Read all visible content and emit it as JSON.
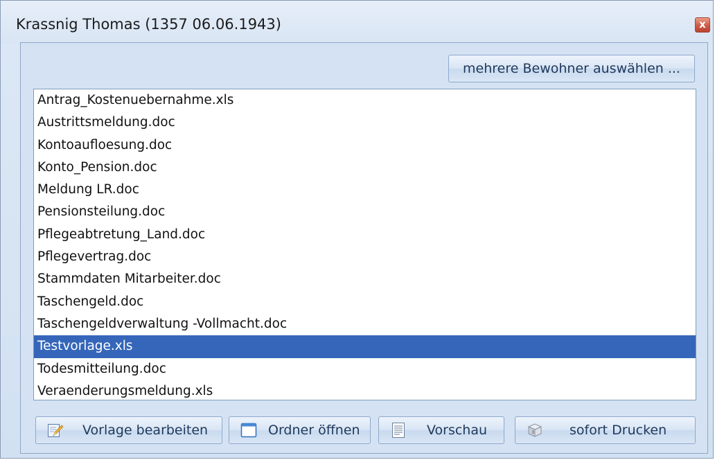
{
  "window": {
    "title": "Krassnig Thomas (1357 06.06.1943)",
    "close_glyph": "x"
  },
  "toolbar": {
    "select_multiple_label": "mehrere Bewohner auswählen ..."
  },
  "templates": {
    "items": [
      {
        "label": "Antrag_Kostenuebernahme.xls",
        "selected": false
      },
      {
        "label": "Austrittsmeldung.doc",
        "selected": false
      },
      {
        "label": "Kontoaufloesung.doc",
        "selected": false
      },
      {
        "label": "Konto_Pension.doc",
        "selected": false
      },
      {
        "label": "Meldung LR.doc",
        "selected": false
      },
      {
        "label": "Pensionsteilung.doc",
        "selected": false
      },
      {
        "label": "Pflegeabtretung_Land.doc",
        "selected": false
      },
      {
        "label": "Pflegevertrag.doc",
        "selected": false
      },
      {
        "label": "Stammdaten Mitarbeiter.doc",
        "selected": false
      },
      {
        "label": "Taschengeld.doc",
        "selected": false
      },
      {
        "label": "Taschengeldverwaltung -Vollmacht.doc",
        "selected": false
      },
      {
        "label": "Testvorlage.xls",
        "selected": true
      },
      {
        "label": "Todesmitteilung.doc",
        "selected": false
      },
      {
        "label": "Veraenderungsmeldung.xls",
        "selected": false
      }
    ]
  },
  "actions": {
    "edit_template_label": "Vorlage bearbeiten",
    "open_folder_label": "Ordner öffnen",
    "preview_label": "Vorschau",
    "print_now_label": "sofort Drucken"
  },
  "icons": {
    "edit": "edit-icon",
    "folder": "window-icon",
    "preview": "document-icon",
    "print": "box-icon",
    "close": "close-icon"
  },
  "colors": {
    "selection": "#3566b9",
    "button_text": "#1e395b",
    "close_button": "#cf5a45"
  }
}
